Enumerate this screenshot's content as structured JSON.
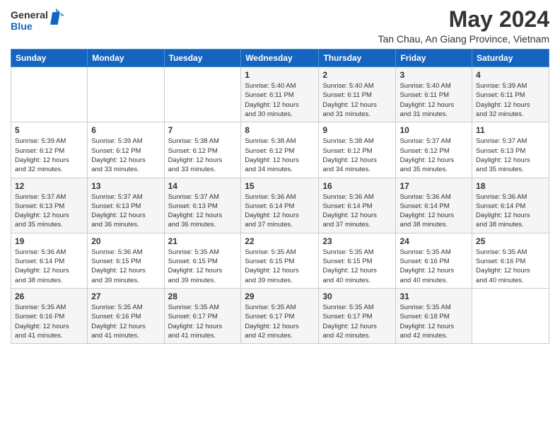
{
  "header": {
    "logo_general": "General",
    "logo_blue": "Blue",
    "month_year": "May 2024",
    "location": "Tan Chau, An Giang Province, Vietnam"
  },
  "days_of_week": [
    "Sunday",
    "Monday",
    "Tuesday",
    "Wednesday",
    "Thursday",
    "Friday",
    "Saturday"
  ],
  "weeks": [
    [
      {
        "day": "",
        "info": ""
      },
      {
        "day": "",
        "info": ""
      },
      {
        "day": "",
        "info": ""
      },
      {
        "day": "1",
        "info": "Sunrise: 5:40 AM\nSunset: 6:11 PM\nDaylight: 12 hours\nand 30 minutes."
      },
      {
        "day": "2",
        "info": "Sunrise: 5:40 AM\nSunset: 6:11 PM\nDaylight: 12 hours\nand 31 minutes."
      },
      {
        "day": "3",
        "info": "Sunrise: 5:40 AM\nSunset: 6:11 PM\nDaylight: 12 hours\nand 31 minutes."
      },
      {
        "day": "4",
        "info": "Sunrise: 5:39 AM\nSunset: 6:11 PM\nDaylight: 12 hours\nand 32 minutes."
      }
    ],
    [
      {
        "day": "5",
        "info": "Sunrise: 5:39 AM\nSunset: 6:12 PM\nDaylight: 12 hours\nand 32 minutes."
      },
      {
        "day": "6",
        "info": "Sunrise: 5:39 AM\nSunset: 6:12 PM\nDaylight: 12 hours\nand 33 minutes."
      },
      {
        "day": "7",
        "info": "Sunrise: 5:38 AM\nSunset: 6:12 PM\nDaylight: 12 hours\nand 33 minutes."
      },
      {
        "day": "8",
        "info": "Sunrise: 5:38 AM\nSunset: 6:12 PM\nDaylight: 12 hours\nand 34 minutes."
      },
      {
        "day": "9",
        "info": "Sunrise: 5:38 AM\nSunset: 6:12 PM\nDaylight: 12 hours\nand 34 minutes."
      },
      {
        "day": "10",
        "info": "Sunrise: 5:37 AM\nSunset: 6:12 PM\nDaylight: 12 hours\nand 35 minutes."
      },
      {
        "day": "11",
        "info": "Sunrise: 5:37 AM\nSunset: 6:13 PM\nDaylight: 12 hours\nand 35 minutes."
      }
    ],
    [
      {
        "day": "12",
        "info": "Sunrise: 5:37 AM\nSunset: 6:13 PM\nDaylight: 12 hours\nand 35 minutes."
      },
      {
        "day": "13",
        "info": "Sunrise: 5:37 AM\nSunset: 6:13 PM\nDaylight: 12 hours\nand 36 minutes."
      },
      {
        "day": "14",
        "info": "Sunrise: 5:37 AM\nSunset: 6:13 PM\nDaylight: 12 hours\nand 36 minutes."
      },
      {
        "day": "15",
        "info": "Sunrise: 5:36 AM\nSunset: 6:14 PM\nDaylight: 12 hours\nand 37 minutes."
      },
      {
        "day": "16",
        "info": "Sunrise: 5:36 AM\nSunset: 6:14 PM\nDaylight: 12 hours\nand 37 minutes."
      },
      {
        "day": "17",
        "info": "Sunrise: 5:36 AM\nSunset: 6:14 PM\nDaylight: 12 hours\nand 38 minutes."
      },
      {
        "day": "18",
        "info": "Sunrise: 5:36 AM\nSunset: 6:14 PM\nDaylight: 12 hours\nand 38 minutes."
      }
    ],
    [
      {
        "day": "19",
        "info": "Sunrise: 5:36 AM\nSunset: 6:14 PM\nDaylight: 12 hours\nand 38 minutes."
      },
      {
        "day": "20",
        "info": "Sunrise: 5:36 AM\nSunset: 6:15 PM\nDaylight: 12 hours\nand 39 minutes."
      },
      {
        "day": "21",
        "info": "Sunrise: 5:35 AM\nSunset: 6:15 PM\nDaylight: 12 hours\nand 39 minutes."
      },
      {
        "day": "22",
        "info": "Sunrise: 5:35 AM\nSunset: 6:15 PM\nDaylight: 12 hours\nand 39 minutes."
      },
      {
        "day": "23",
        "info": "Sunrise: 5:35 AM\nSunset: 6:15 PM\nDaylight: 12 hours\nand 40 minutes."
      },
      {
        "day": "24",
        "info": "Sunrise: 5:35 AM\nSunset: 6:16 PM\nDaylight: 12 hours\nand 40 minutes."
      },
      {
        "day": "25",
        "info": "Sunrise: 5:35 AM\nSunset: 6:16 PM\nDaylight: 12 hours\nand 40 minutes."
      }
    ],
    [
      {
        "day": "26",
        "info": "Sunrise: 5:35 AM\nSunset: 6:16 PM\nDaylight: 12 hours\nand 41 minutes."
      },
      {
        "day": "27",
        "info": "Sunrise: 5:35 AM\nSunset: 6:16 PM\nDaylight: 12 hours\nand 41 minutes."
      },
      {
        "day": "28",
        "info": "Sunrise: 5:35 AM\nSunset: 6:17 PM\nDaylight: 12 hours\nand 41 minutes."
      },
      {
        "day": "29",
        "info": "Sunrise: 5:35 AM\nSunset: 6:17 PM\nDaylight: 12 hours\nand 42 minutes."
      },
      {
        "day": "30",
        "info": "Sunrise: 5:35 AM\nSunset: 6:17 PM\nDaylight: 12 hours\nand 42 minutes."
      },
      {
        "day": "31",
        "info": "Sunrise: 5:35 AM\nSunset: 6:18 PM\nDaylight: 12 hours\nand 42 minutes."
      },
      {
        "day": "",
        "info": ""
      }
    ]
  ]
}
